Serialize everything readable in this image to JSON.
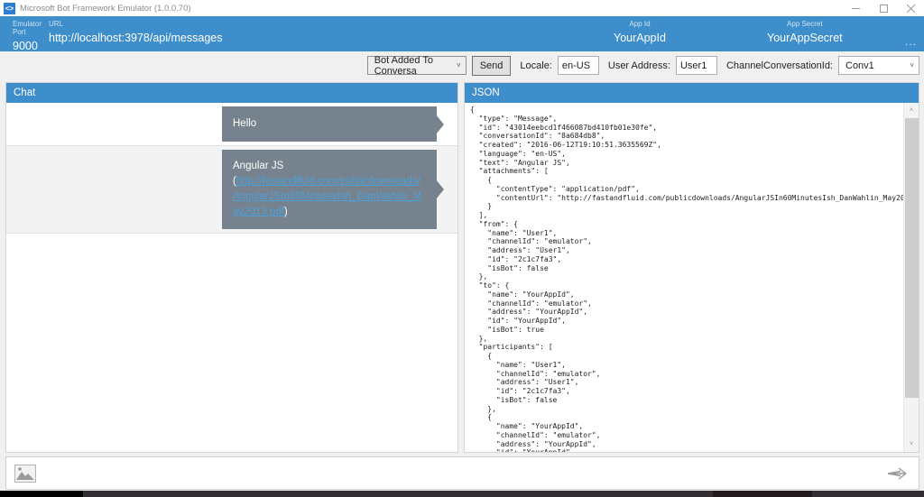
{
  "window": {
    "title": "Microsoft Bot Framework Emulator (1.0.0.70)",
    "app_icon_glyph": "<>"
  },
  "header": {
    "accent_color": "#3e8ecb",
    "fields": [
      {
        "label": "Emulator Port",
        "value": "9000"
      },
      {
        "label": "URL",
        "value": "http://localhost:3978/api/messages"
      },
      {
        "label": "App Id",
        "value": "YourAppId"
      },
      {
        "label": "App Secret",
        "value": "YourAppSecret"
      }
    ],
    "more": "..."
  },
  "toolbar": {
    "conversation_type_value": "Bot Added To Conversa",
    "send_label": "Send",
    "locale_label": "Locale:",
    "locale_value": "en-US",
    "user_address_label": "User Address:",
    "user_address_value": "User1",
    "channel_conversation_label": "ChannelConversationId:",
    "channel_conversation_value": "Conv1"
  },
  "icons": {
    "chevron_down": "˅",
    "scroll_up": "˄",
    "scroll_down": "˅"
  },
  "chat": {
    "title": "Chat",
    "bubble_color": "#76838e",
    "messages": [
      {
        "text": "Hello"
      },
      {
        "prefix": "Angular JS (",
        "link": "http://fastandfluid.com/publicdownloads/AngularJSIn60MinutesIsh_DanWahlin_May2013.pdf",
        "suffix": ")"
      }
    ]
  },
  "json_panel": {
    "title": "JSON",
    "content": "{\n  \"type\": \"Message\",\n  \"id\": \"43014eebcd1f466087bd410fb01e30fe\",\n  \"conversationId\": \"8a684db8\",\n  \"created\": \"2016-06-12T19:10:51.3635569Z\",\n  \"language\": \"en-US\",\n  \"text\": \"Angular JS\",\n  \"attachments\": [\n    {\n      \"contentType\": \"application/pdf\",\n      \"contentUrl\": \"http://fastandfluid.com/publicdownloads/AngularJSIn60MinutesIsh_DanWahlin_May2013.pdf\"\n    }\n  ],\n  \"from\": {\n    \"name\": \"User1\",\n    \"channelId\": \"emulator\",\n    \"address\": \"User1\",\n    \"id\": \"2c1c7fa3\",\n    \"isBot\": false\n  },\n  \"to\": {\n    \"name\": \"YourAppId\",\n    \"channelId\": \"emulator\",\n    \"address\": \"YourAppId\",\n    \"id\": \"YourAppId\",\n    \"isBot\": true\n  },\n  \"participants\": [\n    {\n      \"name\": \"User1\",\n      \"channelId\": \"emulator\",\n      \"address\": \"User1\",\n      \"id\": \"2c1c7fa3\",\n      \"isBot\": false\n    },\n    {\n      \"name\": \"YourAppId\",\n      \"channelId\": \"emulator\",\n      \"address\": \"YourAppId\",\n      \"id\": \"YourAppId\",\n      \"isBot\": true"
  }
}
